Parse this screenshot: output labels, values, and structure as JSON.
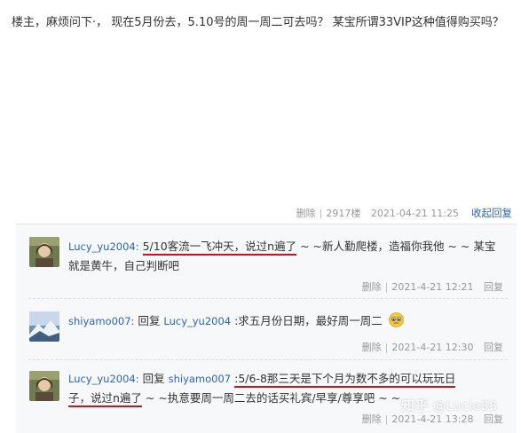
{
  "post": {
    "text": "楼主，麻烦问下·，  现在5月份去，5.10号的周一周二可去吗？  某宝所谓33VIP这种值得购买吗？",
    "delete_label": "删除",
    "floor": "2917楼",
    "timestamp": "2021-04-21 11:25",
    "collapse_label": "收起回复"
  },
  "replies": [
    {
      "username": "Lucy_yu2004:",
      "highlight": "5/10客流一飞冲天，说过n遍了",
      "rest": "~ ~新人勤爬楼，造福你我他 ~ ~ 某宝就是黄牛，自己判断吧",
      "delete_label": "删除",
      "timestamp": "2021-4-21 12:21",
      "reply_label": "回复",
      "avatar_icon": "portrait-avatar"
    },
    {
      "username": "shiyamo007:",
      "reply_prefix": "回复",
      "reply_to": "Lucy_yu2004",
      "text": ":求五月份日期，最好周一周二",
      "emoji": "pleading-face-emoji",
      "delete_label": "删除",
      "timestamp": "2021-4-21 12:30",
      "reply_label": "回复",
      "avatar_icon": "snow-mountain-avatar"
    },
    {
      "username": "Lucy_yu2004:",
      "reply_prefix": "回复",
      "reply_to": "shiyamo007",
      "highlight_1": ":5/6-8那三天是下个月为数不多的可以玩玩日",
      "highlight_2": "子，说过n遍了",
      "rest": "~ ~执意要周一周二去的话买礼宾/早享/尊享吧 ~ ~",
      "delete_label": "删除",
      "timestamp": "2021-4-21 13:28",
      "reply_label": "回复",
      "avatar_icon": "portrait-avatar"
    }
  ],
  "watermark": {
    "logo": "知乎",
    "handle": "@Lucie88"
  },
  "colors": {
    "link": "#2d64b3",
    "highlight_underline": "#c8141e",
    "meta": "#999999",
    "reply_bg": "#f7f8fa"
  }
}
